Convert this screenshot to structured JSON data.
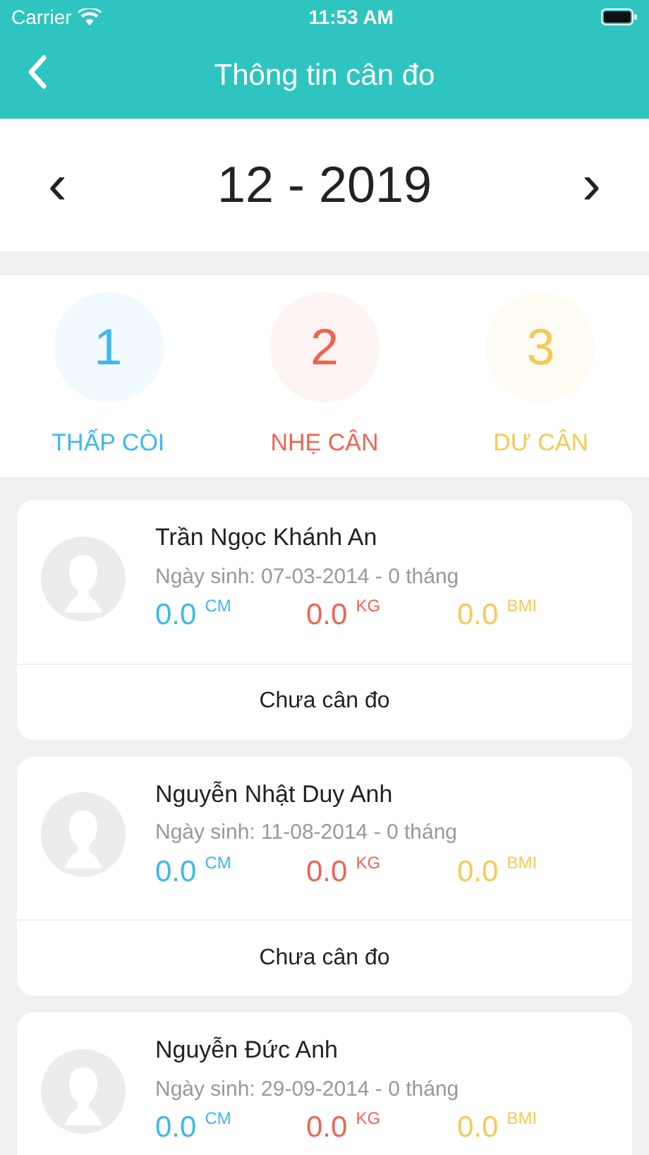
{
  "status_bar": {
    "carrier": "Carrier",
    "time": "11:53 AM"
  },
  "header": {
    "title": "Thông tin cân đo"
  },
  "period": {
    "prev": "‹",
    "label": "12 - 2019",
    "next": "›"
  },
  "summary": [
    {
      "count": "1",
      "label": "THẤP CÒI",
      "color": "#3db8f0"
    },
    {
      "count": "2",
      "label": "NHẸ CÂN",
      "color": "#ef6450"
    },
    {
      "count": "3",
      "label": "DƯ CÂN",
      "color": "#f7c955"
    }
  ],
  "children": [
    {
      "name": "Trần Ngọc Khánh An",
      "birth": "Ngày sinh: 07-03-2014 - 0 tháng",
      "measures": [
        {
          "value": "0.0",
          "unit": "CM",
          "color": "#3db8f0"
        },
        {
          "value": "0.0",
          "unit": "KG",
          "color": "#ef6450"
        },
        {
          "value": "0.0",
          "unit": "BMI",
          "color": "#f7c955"
        }
      ],
      "status": "Chưa cân đo"
    },
    {
      "name": "Nguyễn Nhật Duy Anh",
      "birth": "Ngày sinh: 11-08-2014 - 0 tháng",
      "measures": [
        {
          "value": "0.0",
          "unit": "CM",
          "color": "#3db8f0"
        },
        {
          "value": "0.0",
          "unit": "KG",
          "color": "#ef6450"
        },
        {
          "value": "0.0",
          "unit": "BMI",
          "color": "#f7c955"
        }
      ],
      "status": "Chưa cân đo"
    },
    {
      "name": "Nguyễn Đức Anh",
      "birth": "Ngày sinh: 29-09-2014 - 0 tháng",
      "measures": [
        {
          "value": "0.0",
          "unit": "CM",
          "color": "#3db8f0"
        },
        {
          "value": "0.0",
          "unit": "KG",
          "color": "#ef6450"
        },
        {
          "value": "0.0",
          "unit": "BMI",
          "color": "#f7c955"
        }
      ]
    }
  ]
}
